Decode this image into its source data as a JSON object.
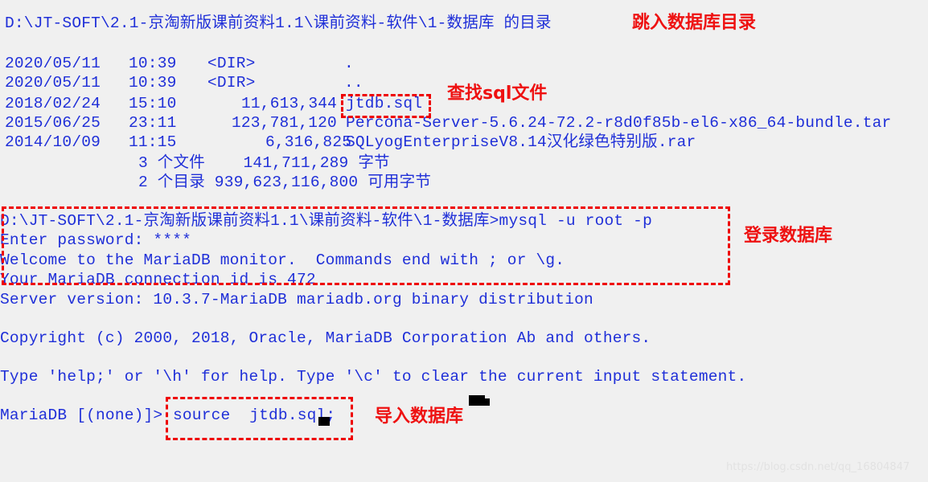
{
  "colors": {
    "background": "#f0f0f0",
    "terminal_text": "#1f2fd8",
    "annotation_red": "#ee1111",
    "box_red": "#ee0000",
    "cursor": "#000000",
    "watermark": "#e2e2e2"
  },
  "header": {
    "directory_line": "D:\\JT-SOFT\\2.1-京淘新版课前资料1.1\\课前资料-软件\\1-数据库 的目录"
  },
  "listing": {
    "rows": [
      {
        "date": "2020/05/11",
        "time": "10:39",
        "size": "<DIR>",
        "name": "."
      },
      {
        "date": "2020/05/11",
        "time": "10:39",
        "size": "<DIR>",
        "name": ".."
      },
      {
        "date": "2018/02/24",
        "time": "15:10",
        "size": "11,613,344",
        "name": "jtdb.sql"
      },
      {
        "date": "2015/06/25",
        "time": "23:11",
        "size": "123,781,120",
        "name": "Percona-Server-5.6.24-72.2-r8d0f85b-el6-x86_64-bundle.tar"
      },
      {
        "date": "2014/10/09",
        "time": "11:15",
        "size": "6,316,825",
        "name": "SQLyogEnterpriseV8.14汉化绿色特别版.rar"
      }
    ],
    "summary_files": "3 个文件    141,711,289 字节",
    "summary_dirs": "2 个目录 939,623,116,800 可用字节"
  },
  "session": {
    "prompt_line": "D:\\JT-SOFT\\2.1-京淘新版课前资料1.1\\课前资料-软件\\1-数据库>mysql -u root -p",
    "password_line": "Enter password: ****",
    "welcome_line": "Welcome to the MariaDB monitor.  Commands end with ; or \\g.",
    "connection_line": "Your MariaDB connection id is 472",
    "server_version_line": "Server version: 10.3.7-MariaDB mariadb.org binary distribution",
    "copyright_line": "Copyright (c) 2000, 2018, Oracle, MariaDB Corporation Ab and others.",
    "help_line": "Type 'help;' or '\\h' for help. Type '\\c' to clear the current input statement.",
    "mariadb_prompt": "MariaDB [(none)]>",
    "source_command": "source  jtdb.sql;"
  },
  "annotations": {
    "jump_dir": "跳入数据库目录",
    "find_sql": "查找sql文件",
    "login_db": "登录数据库",
    "import_db": "导入数据库"
  },
  "watermark": {
    "text": "https://blog.csdn.net/qq_16804847"
  }
}
